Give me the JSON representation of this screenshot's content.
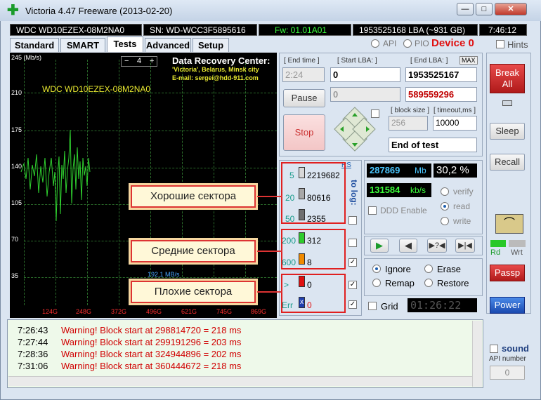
{
  "window": {
    "title": "Victoria 4.47  Freeware (2013-02-20)",
    "btn_min": "—",
    "btn_max": "□",
    "btn_close": "✕"
  },
  "infobar": {
    "model": "WDC WD10EZEX-08M2NA0",
    "serial": "SN: WD-WCC3F5895616",
    "firmware": "Fw: 01.01A01",
    "lba": "1953525168 LBA (~931 GB)",
    "time": "7:46:12"
  },
  "tabs": [
    "Standard",
    "SMART",
    "Tests",
    "Advanced",
    "Setup"
  ],
  "mode": {
    "api": "API",
    "pio": "PIO",
    "device": "Device 0",
    "hints": "Hints"
  },
  "graph": {
    "unit": "245 (Mb/s)",
    "drive": "WDC WD10EZEX-08M2NA0",
    "y_ticks": [
      "210",
      "175",
      "140",
      "105",
      "70",
      "35"
    ],
    "x_ticks": [
      "124G",
      "248G",
      "372G",
      "496G",
      "621G",
      "745G",
      "869G"
    ],
    "speed": "192,1 MB/s",
    "step_minus": "−",
    "step_value": "4",
    "step_plus": "+",
    "ad_title": "Data Recovery Center:",
    "ad_line1": "'Victoria', Belarus, Minsk city",
    "ad_line2": "E-mail: sergei@hdd-911.com"
  },
  "controls": {
    "end_time_label": "[ End time ]",
    "end_time": "2:24",
    "start_lba_label": "[ Start LBA: ]",
    "start_lba": "0",
    "end_lba_label": "[ End LBA: ]",
    "max": "MAX",
    "end_lba": "1953525167",
    "pause": "Pause",
    "second_start": "0",
    "second_end": "589559296",
    "stop": "Stop",
    "block_size_label": "[ block size ]",
    "block_size": "256",
    "timeout_label": "[ timeout,ms ]",
    "timeout": "10000",
    "end_of_test": "End of test"
  },
  "stats": {
    "rs": "RS",
    "to_log": "to log:",
    "rows": [
      {
        "ms": "5",
        "count": "2219682"
      },
      {
        "ms": "20",
        "count": "80616"
      },
      {
        "ms": "50",
        "count": "2355"
      },
      {
        "ms": "200",
        "count": "312"
      },
      {
        "ms": "600",
        "count": "8"
      },
      {
        "ms": ">",
        "count": "0"
      },
      {
        "ms": "Err",
        "count": "0"
      }
    ]
  },
  "callouts": {
    "good": "Хорошие сектора",
    "medium": "Средние сектора",
    "bad": "Плохие сектора"
  },
  "speeds": {
    "mb": "287869",
    "mb_unit": "Mb",
    "pct": "30,2 %",
    "kbs": "131584",
    "kbs_unit": "kb/s",
    "verify": "verify",
    "read": "read",
    "write": "write",
    "ddd": "DDD Enable"
  },
  "actions": {
    "ignore": "Ignore",
    "erase": "Erase",
    "remap": "Remap",
    "restore": "Restore",
    "grid": "Grid",
    "timer": "01:26:22"
  },
  "side": {
    "break": "Break All",
    "sleep": "Sleep",
    "recall": "Recall",
    "rd": "Rd",
    "wrt": "Wrt",
    "passp": "Passp",
    "power": "Power",
    "sound": "sound",
    "api_number": "API number",
    "api_value": "0"
  },
  "log": [
    {
      "time": "7:26:43",
      "msg": "Warning! Block start at 298814720 = 218 ms"
    },
    {
      "time": "7:27:44",
      "msg": "Warning! Block start at 299191296 = 203 ms"
    },
    {
      "time": "7:28:36",
      "msg": "Warning! Block start at 324944896 = 202 ms"
    },
    {
      "time": "7:31:06",
      "msg": "Warning! Block start at 360444672 = 218 ms"
    }
  ]
}
